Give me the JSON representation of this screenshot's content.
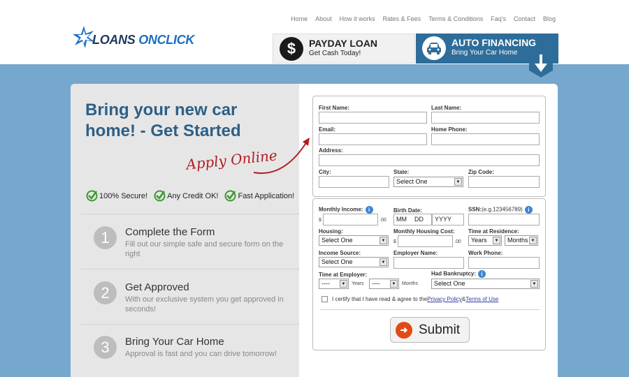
{
  "nav": [
    "Home",
    "About",
    "How it works",
    "Rates & Fees",
    "Terms & Conditions",
    "Faq's",
    "Contact",
    "Blog"
  ],
  "logo": {
    "part1": "LOANS ",
    "part2": "ONCLICK"
  },
  "tabs": [
    {
      "icon": "dollar-icon",
      "symbol": "$",
      "title": "PAYDAY LOAN",
      "subtitle": "Get Cash Today!"
    },
    {
      "icon": "car-icon",
      "title": "AUTO FINANCING",
      "subtitle": "Bring Your Car Home"
    }
  ],
  "hero": {
    "line1": "Bring your new car",
    "line2": "home! - Get Started",
    "apply": "Apply Online"
  },
  "checks": [
    "100% Secure!",
    "Any Credit OK!",
    "Fast Application!"
  ],
  "steps": [
    {
      "num": "1",
      "title": "Complete the Form",
      "desc": "Fill out our simple safe and secure form on the right"
    },
    {
      "num": "2",
      "title": "Get Approved",
      "desc": "With our exclusive system you get approved in seconds!"
    },
    {
      "num": "3",
      "title": "Bring Your Car Home",
      "desc": "Approval is fast and you can drive tomorrow!"
    }
  ],
  "form1": {
    "first_name": "First Name:",
    "last_name": "Last Name:",
    "email": "Email:",
    "home_phone": "Home Phone:",
    "address": "Address:",
    "city": "City:",
    "state": "State:",
    "state_value": "Select One",
    "zip": "Zip Code:"
  },
  "form2": {
    "monthly_income": "Monthly Income:",
    "dollar": "$",
    "cents": ".00",
    "birth_date": "Birth Date:",
    "mm": "MM",
    "dd": "DD",
    "yyyy": "YYYY",
    "ssn": "SSN:",
    "ssn_hint": "(e.g.123456789)",
    "housing": "Housing:",
    "housing_value": "Select One",
    "monthly_housing": "Monthly Housing Cost:",
    "time_res": "Time at Residence:",
    "years_value": "Years",
    "months_value": "Months",
    "income_source": "Income Source:",
    "income_value": "Select One",
    "employer": "Employer Name:",
    "work_phone": "Work Phone:",
    "time_emp": "Time at Employer:",
    "dash": "----",
    "years_label": "Years",
    "months_label": "Months",
    "bankruptcy": "Had Bankruptcy:",
    "bankruptcy_value": "Select One",
    "certify_text": "I certify that I have read & agree to the ",
    "privacy": "Privacy Policy",
    "amp": " & ",
    "terms": "Terms of Use"
  },
  "submit": "Submit"
}
